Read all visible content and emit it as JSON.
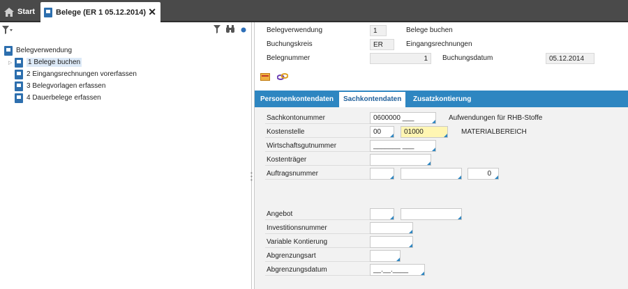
{
  "tabs": {
    "start_label": "Start",
    "active_label": "Belege (ER 1 05.12.2014)"
  },
  "left_panel": {
    "root_label": "Belegverwendung",
    "items": [
      {
        "label": "1  Belege buchen"
      },
      {
        "label": "2  Eingangsrechnungen vorerfassen"
      },
      {
        "label": "3  Belegvorlagen erfassen"
      },
      {
        "label": "4  Dauerbelege erfassen"
      }
    ]
  },
  "header": {
    "belegverwendung_label": "Belegverwendung",
    "belegverwendung_value": "1",
    "belegverwendung_desc": "Belege buchen",
    "buchungskreis_label": "Buchungskreis",
    "buchungskreis_value": "ER",
    "buchungskreis_desc": "Eingangsrechnungen",
    "belegnummer_label": "Belegnummer",
    "belegnummer_value": "1",
    "buchungsdatum_label": "Buchungsdatum",
    "buchungsdatum_value": "05.12.2014"
  },
  "detail_tabs": [
    {
      "label": "Personenkontendaten"
    },
    {
      "label": "Sachkontendaten"
    },
    {
      "label": "Zusatzkontierung"
    }
  ],
  "form": {
    "sachkontonummer_label": "Sachkontonummer",
    "sachkontonummer_value": "0600000 ___",
    "sachkontonummer_desc": "Aufwendungen für RHB-Stoffe",
    "kostenstelle_label": "Kostenstelle",
    "kostenstelle_value1": "00",
    "kostenstelle_value2": "01000",
    "kostenstelle_desc": "MATERIALBEREICH",
    "wirtschaftsgutnummer_label": "Wirtschaftsgutnummer",
    "wirtschaftsgutnummer_value": "_______ ___",
    "kostentraeger_label": "Kostenträger",
    "auftragsnummer_label": "Auftragsnummer",
    "auftragsnummer_value3": "0",
    "angebot_label": "Angebot",
    "investitionsnummer_label": "Investitionsnummer",
    "variable_kontierung_label": "Variable Kontierung",
    "abgrenzungsart_label": "Abgrenzungsart",
    "abgrenzungsdatum_label": "Abgrenzungsdatum",
    "abgrenzungsdatum_value": "__.__.____"
  },
  "colors": {
    "tab_bar": "#2e86c1",
    "topbar": "#4a4a4a",
    "highlight_field": "#fff6b3"
  }
}
